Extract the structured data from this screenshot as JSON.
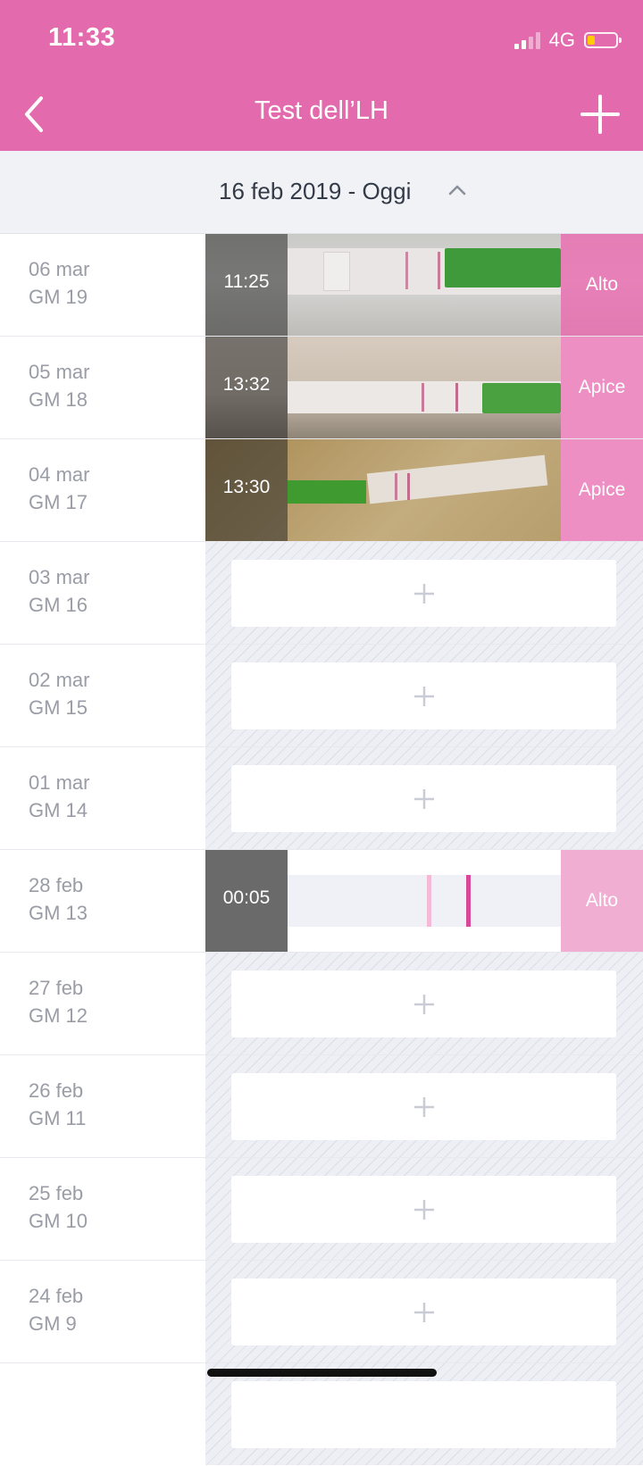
{
  "status_bar": {
    "time": "11:33",
    "network": "4G"
  },
  "header": {
    "title": "Test dell’LH"
  },
  "range": {
    "label": "16 feb 2019 - Oggi"
  },
  "rows": [
    {
      "date": "06 mar",
      "day": "GM 19",
      "time": "11:25",
      "result": "Alto"
    },
    {
      "date": "05 mar",
      "day": "GM 18",
      "time": "13:32",
      "result": "Apice"
    },
    {
      "date": "04 mar",
      "day": "GM 17",
      "time": "13:30",
      "result": "Apice"
    },
    {
      "date": "03 mar",
      "day": "GM 16"
    },
    {
      "date": "02 mar",
      "day": "GM 15"
    },
    {
      "date": "01 mar",
      "day": "GM 14"
    },
    {
      "date": "28 feb",
      "day": "GM 13",
      "time": "00:05",
      "result": "Alto"
    },
    {
      "date": "27 feb",
      "day": "GM 12"
    },
    {
      "date": "26 feb",
      "day": "GM 11"
    },
    {
      "date": "25 feb",
      "day": "GM 10"
    },
    {
      "date": "24 feb",
      "day": "GM 9"
    }
  ],
  "colors": {
    "brand": "#e36aac",
    "peak": "#ee8fc4",
    "high_light": "#f0aed3"
  }
}
